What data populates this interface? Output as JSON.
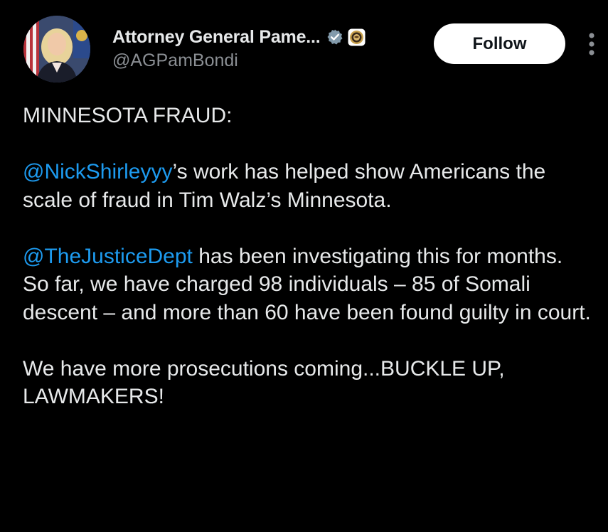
{
  "author": {
    "display_name": "Attorney General Pame...",
    "handle": "@AGPamBondi",
    "verified_icon": "verified-badge-icon",
    "affiliation_icon": "doj-seal-icon"
  },
  "actions": {
    "follow_label": "Follow",
    "more_icon": "more-vertical-icon"
  },
  "tweet": {
    "heading": "MINNESOTA FRAUD:",
    "p1_mention": "@NickShirleyyy",
    "p1_text": "’s work has helped show Americans the scale of fraud in Tim Walz’s Minnesota.",
    "p2_mention": "@TheJusticeDept",
    "p2_text": " has been investigating this for months. So far, we have charged 98 individuals – 85 of Somali descent – and more than 60 have been found guilty in court.",
    "p3_text": "We have more prosecutions coming...BUCKLE UP, LAWMAKERS!"
  },
  "colors": {
    "background": "#000000",
    "text": "#e7e9ea",
    "secondary_text": "#8b8f94",
    "mention": "#1d9bf0",
    "follow_button_bg": "#ffffff"
  }
}
